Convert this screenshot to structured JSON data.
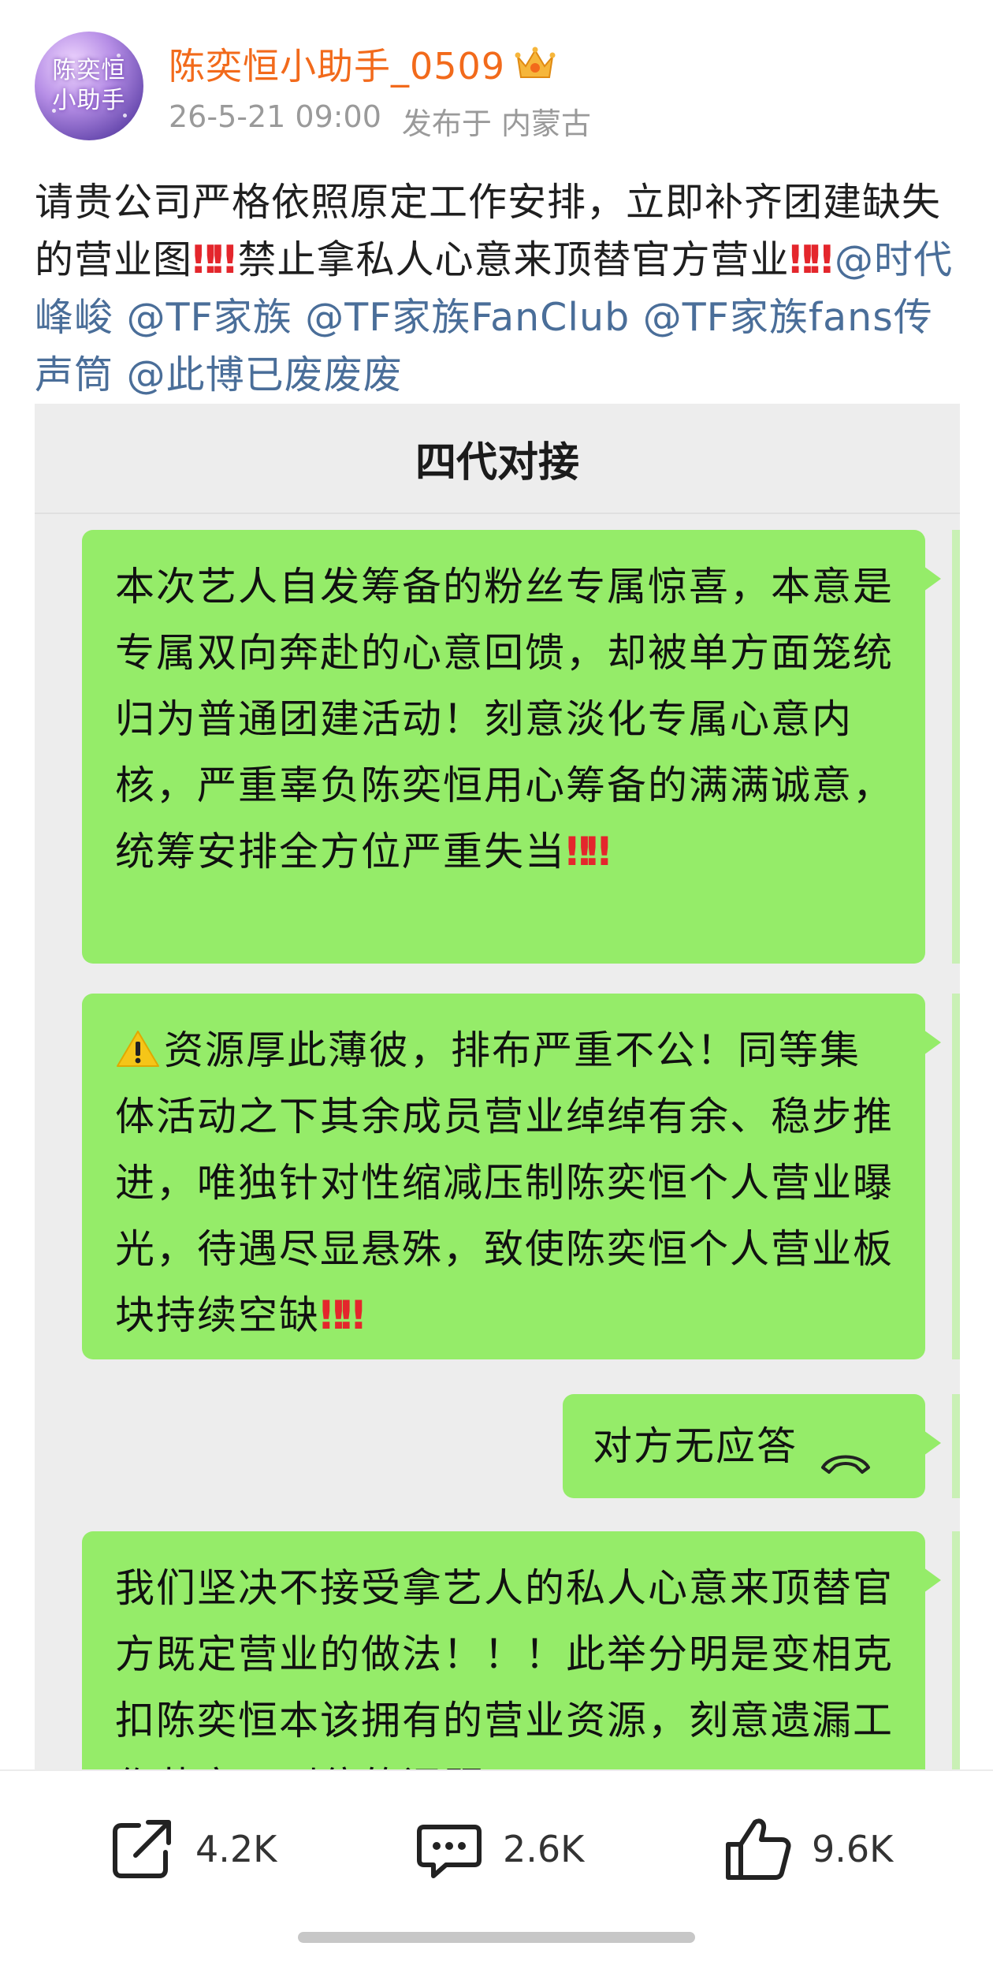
{
  "post": {
    "author": {
      "name": "陈奕恒小助手_0509",
      "avatar_text_line1": "陈奕恒",
      "avatar_text_line2": "小助手",
      "badge_icon": "crown-vip-icon"
    },
    "timestamp": "26-5-21 09:00",
    "location": "发布于 内蒙古",
    "text": {
      "part1": "请贵公司严格依照原定工作安排，立即补齐团建缺失的营业图",
      "bang1": "‼‼",
      "part2": "禁止拿私人心意来顶替官方营业",
      "bang2": "‼‼",
      "mentions": [
        "@时代峰峻",
        "@TF家族",
        "@TF家族FanClub",
        "@TF家族fans传声筒",
        "@此博已废废废"
      ]
    },
    "image": {
      "chat_title": "四代对接",
      "messages": [
        {
          "text": "本次艺人自发筹备的粉丝专属惊喜，本意是专属双向奔赴的心意回馈，却被单方面笼统归为普通团建活动！刻意淡化专属心意内核，严重辜负陈奕恒用心筹备的满满诚意，统筹安排全方位严重失当",
          "emphasis": "‼‼"
        },
        {
          "icon": "warning-icon",
          "text": "资源厚此薄彼，排布严重不公！同等集体活动之下其余成员营业绰绰有余、稳步推进，唯独针对性缩减压制陈奕恒个人营业曝光，待遇尽显悬殊，致使陈奕恒个人营业板块持续空缺",
          "emphasis": "‼‼"
        },
        {
          "text": "对方无应答",
          "icon": "hang-up-icon"
        },
        {
          "text": "我们坚决不接受拿艺人的私人心意来顶替官方既定营业的做法！！！此举分明是变相克扣陈奕恒本该拥有的营业资源，刻意遗漏工作落实不到位的问题"
        }
      ]
    }
  },
  "actions": {
    "share": {
      "icon": "share-icon",
      "count": "4.2K"
    },
    "comment": {
      "icon": "comment-icon",
      "count": "2.6K"
    },
    "like": {
      "icon": "thumbs-up-icon",
      "count": "9.6K"
    }
  },
  "colors": {
    "author_name": "#f26a1b",
    "mention": "#4a6e99",
    "bubble": "#95ec69",
    "alert": "#e4262c"
  }
}
